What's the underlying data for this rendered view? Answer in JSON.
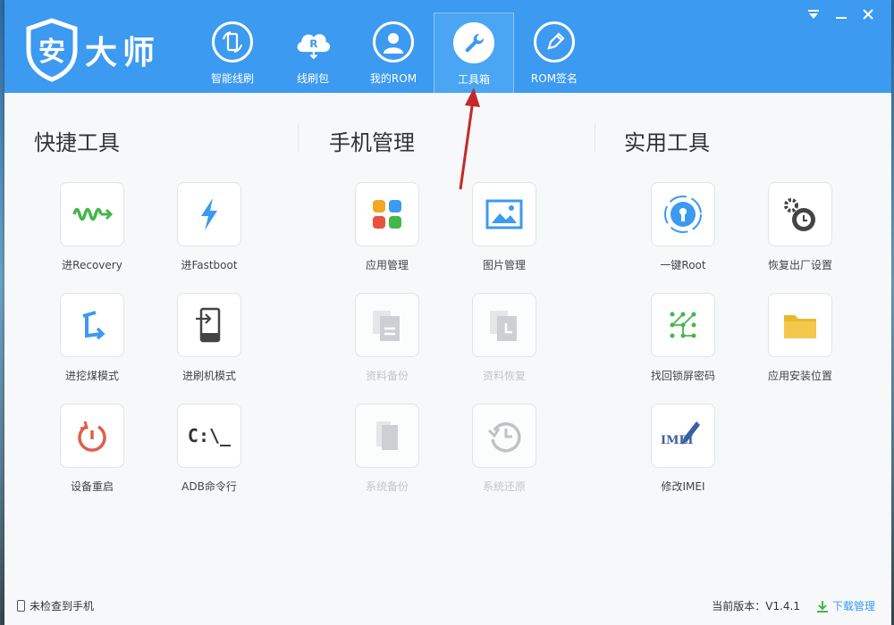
{
  "app": {
    "logo_text": "大师",
    "logo_char": "安"
  },
  "nav": [
    {
      "label": "智能线刷",
      "icon": "phone-refresh-icon"
    },
    {
      "label": "线刷包",
      "icon": "cloud-r-icon"
    },
    {
      "label": "我的ROM",
      "icon": "user-icon"
    },
    {
      "label": "工具箱",
      "icon": "wrench-icon",
      "active": true
    },
    {
      "label": "ROM签名",
      "icon": "pen-icon"
    }
  ],
  "sections": {
    "quick": "快捷工具",
    "phone": "手机管理",
    "util": "实用工具"
  },
  "tools": {
    "recovery": "进Recovery",
    "fastboot": "进Fastboot",
    "dig": "进挖煤模式",
    "flash": "进刷机模式",
    "reboot": "设备重启",
    "adb": "ADB命令行",
    "adb_glyph": "C:\\_",
    "app_mgr": "应用管理",
    "pic_mgr": "图片管理",
    "data_backup": "资料备份",
    "data_restore": "资料恢复",
    "sys_backup": "系统备份",
    "sys_restore": "系统还原",
    "root": "一键Root",
    "factory": "恢复出厂设置",
    "lock": "找回锁屏密码",
    "install_loc": "应用安装位置",
    "imei": "修改IMEI",
    "imei_glyph": "IMEI"
  },
  "status": {
    "phone_state": "未检查到手机",
    "version": "当前版本：V1.4.1",
    "download_mgr": "下载管理"
  },
  "colors": {
    "header": "#3c9af0",
    "accent": "#3c9af0"
  }
}
